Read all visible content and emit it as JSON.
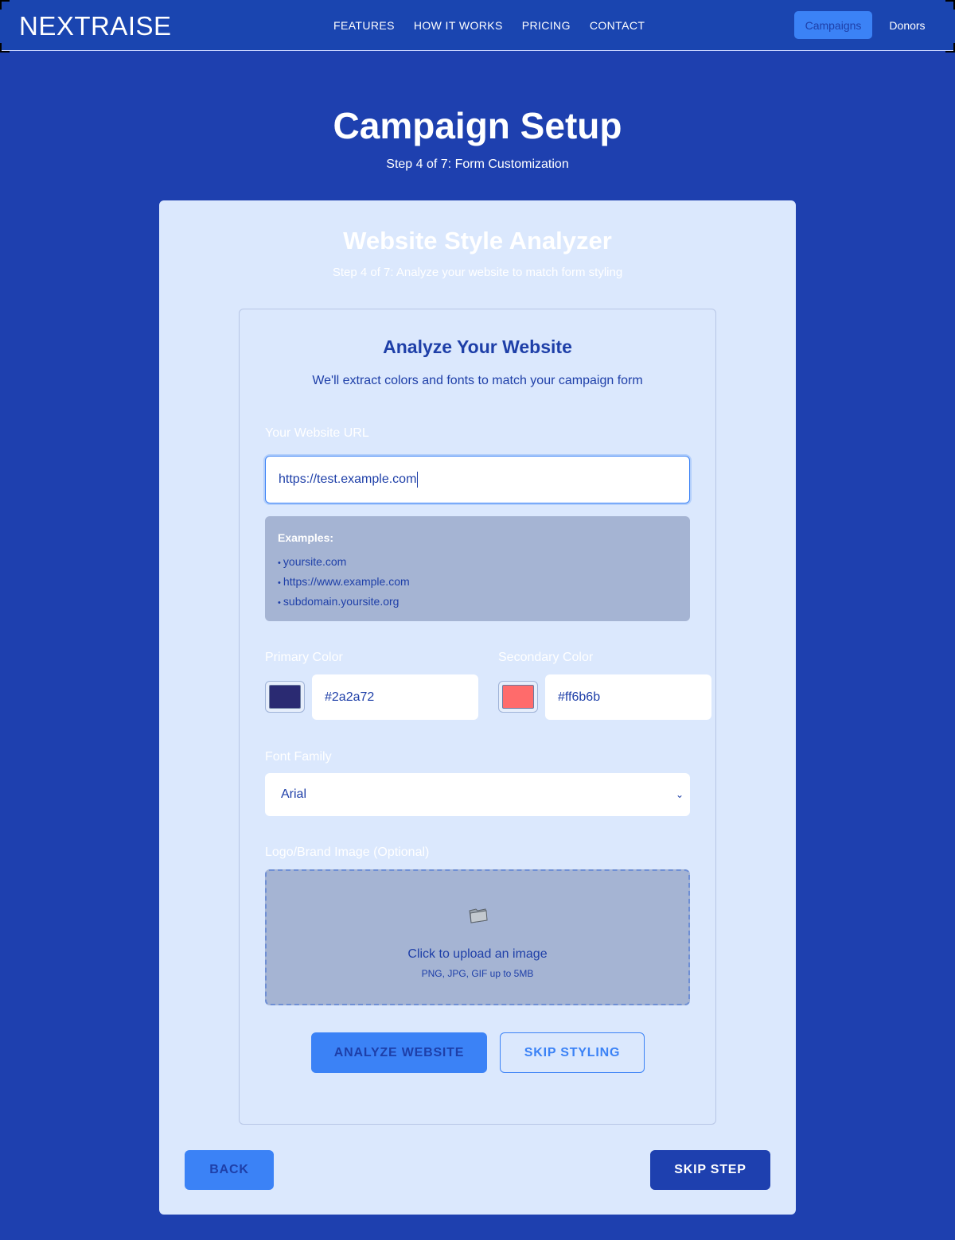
{
  "header": {
    "brand": "NEXTRAISE",
    "nav": [
      "FEATURES",
      "HOW IT WORKS",
      "PRICING",
      "CONTACT"
    ],
    "campaigns_label": "Campaigns",
    "donors_label": "Donors"
  },
  "page": {
    "title": "Campaign Setup",
    "subtitle": "Step 4 of 7: Form Customization"
  },
  "analyzer": {
    "title": "Website Style Analyzer",
    "subtitle": "Step 4 of 7: Analyze your website to match form styling"
  },
  "card": {
    "title": "Analyze Your Website",
    "subtitle": "We'll extract colors and fonts to match your campaign form",
    "url_label": "Your Website URL",
    "url_value": "https://test.example.com",
    "examples_heading": "Examples:",
    "examples": [
      "yoursite.com",
      "https://www.example.com",
      "subdomain.yoursite.org"
    ],
    "primary_label": "Primary Color",
    "primary_value": "#2a2a72",
    "secondary_label": "Secondary Color",
    "secondary_value": "#ff6b6b",
    "font_label": "Font Family",
    "font_value": "Arial",
    "logo_label": "Logo/Brand Image (Optional)",
    "upload_text": "Click to upload an image",
    "upload_hint": "PNG, JPG, GIF up to 5MB",
    "analyze_label": "ANALYZE WEBSITE",
    "skip_styling_label": "SKIP STYLING"
  },
  "footer_buttons": {
    "back_label": "BACK",
    "skip_step_label": "SKIP STEP"
  },
  "colors": {
    "background": "#1e40af",
    "accent": "#3b82f6",
    "primary_swatch": "#2a2a72",
    "secondary_swatch": "#ff6b6b"
  },
  "icons": {
    "upload": "folder-icon"
  }
}
